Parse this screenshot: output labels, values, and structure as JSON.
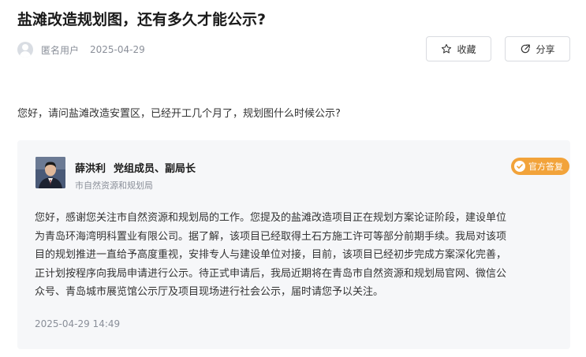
{
  "article": {
    "title": "盐滩改造规划图，还有多久才能公示?",
    "author": "匿名用户",
    "date": "2025-04-29"
  },
  "actions": {
    "favorite_label": "收藏",
    "share_label": "分享"
  },
  "question": {
    "text": "您好，请问盐滩改造安置区，已经开工几个月了，规划图什么时候公示?"
  },
  "answer": {
    "name": "薛洪利",
    "role": "党组成员、副局长",
    "org": "市自然资源和规划局",
    "badge": "官方答复",
    "lines": [
      "您好，感谢您关注市自然资源和规划局的工作。您提及的盐滩改造项目正在规划方案论证阶段，建设单位",
      "为青岛环海湾明科置业有限公司。据了解，该项目已经取得土石方施工许可等部分前期手续。我局对该项",
      "目的规划推进一直给予高度重视，安排专人与建设单位对接，目前，该项目已经初步完成方案深化完善，",
      "正计划按程序向我局申请进行公示。待正式申请后，我局近期将在青岛市自然资源和规划局官网、微信公",
      "众号、青岛城市展览馆公示厅及项目现场进行社会公示，届时请您予以关注。"
    ],
    "time": "2025-04-29 14:49"
  },
  "icons": {
    "favorite": "star-outline-icon",
    "share": "share-arrow-icon",
    "badge": "checkmark-icon",
    "user": "default-user-icon"
  },
  "colors": {
    "badge": "#f2a33a",
    "muted_text": "#8a8f99",
    "answer_bg": "#f6f7f9"
  }
}
